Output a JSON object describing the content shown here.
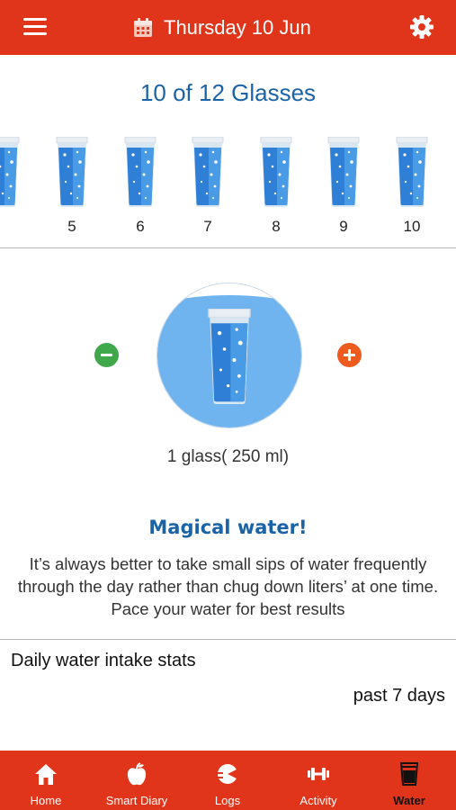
{
  "header": {
    "date": "Thursday 10 Jun",
    "icons": [
      "menu-icon",
      "calendar-icon",
      "gear-icon"
    ]
  },
  "progress": {
    "title": "10 of 12 Glasses",
    "consumed": 10,
    "goal": 12,
    "visible_numbers": [
      "",
      "5",
      "6",
      "7",
      "8",
      "9",
      "10"
    ]
  },
  "selector": {
    "glass_size": "1 glass( 250 ml)",
    "icons": [
      "minus-icon",
      "plus-icon"
    ]
  },
  "tip": {
    "title": "Magical water!",
    "body": "It’s always better to take small sips of water frequently through the day rather than chug down liters’ at one time. Pace your water for best results"
  },
  "stats": {
    "title": "Daily water intake stats",
    "range": "past 7 days"
  },
  "nav": {
    "items": [
      {
        "label": "Home",
        "icon": "home-icon"
      },
      {
        "label": "Smart Diary",
        "icon": "apple-icon"
      },
      {
        "label": "Logs",
        "icon": "logs-icon"
      },
      {
        "label": "Activity",
        "icon": "dumbbell-icon"
      },
      {
        "label": "Water",
        "icon": "water-glass-icon",
        "active": true
      }
    ]
  },
  "colors": {
    "brand": "#e0351b",
    "title_blue": "#1a63a6",
    "water_blue": "#3a8ee0",
    "minus_green": "#3ea84a",
    "plus_orange": "#ef5a1e"
  }
}
